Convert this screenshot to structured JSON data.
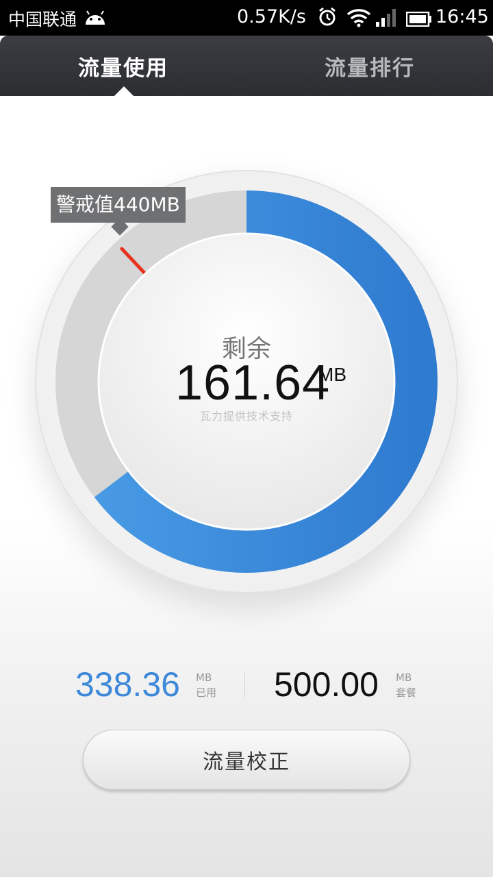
{
  "status_bar": {
    "carrier": "中国联通",
    "speed": "0.57K/s",
    "time": "16:45",
    "icons": [
      "android-icon",
      "alarm-icon",
      "wifi-icon",
      "signal-icon",
      "battery-icon"
    ]
  },
  "tabs": [
    {
      "label": "流量使用",
      "active": true
    },
    {
      "label": "流量排行",
      "active": false
    }
  ],
  "gauge": {
    "center_label": "剩余",
    "remaining_value": "161.64",
    "remaining_unit": "MB",
    "provider_text": "瓦力提供技术支持",
    "warning_tip": "警戒值440MB",
    "remaining_fraction": 0.3233,
    "warning_fraction": 0.88,
    "colors": {
      "remaining": "#3d88d8",
      "used": "#d6d6d6",
      "warning": "#e8321f"
    }
  },
  "stats": {
    "used_value": "338.36",
    "used_unit": "MB",
    "used_label": "已用",
    "plan_value": "500.00",
    "plan_unit": "MB",
    "plan_label": "套餐"
  },
  "calibrate_button": "流量校正"
}
